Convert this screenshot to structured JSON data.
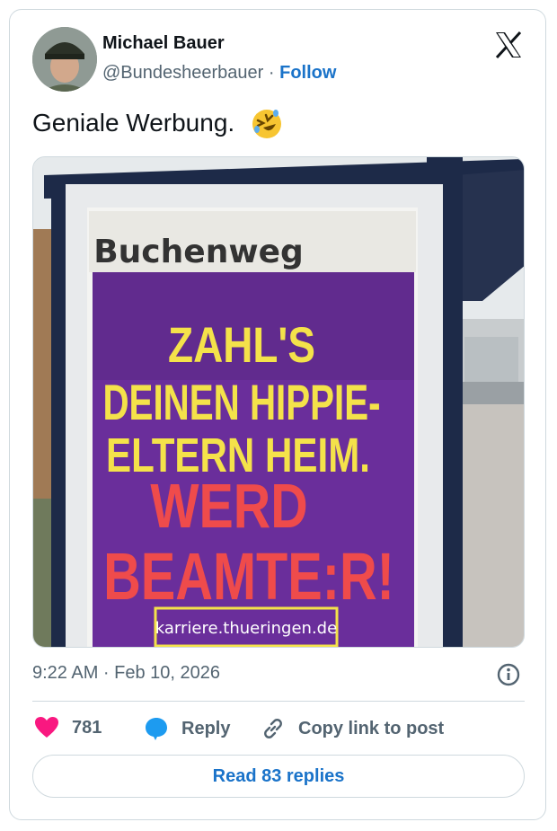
{
  "author": {
    "name": "Michael Bauer",
    "handle": "@Bundesheerbauer",
    "separator": " · ",
    "follow_label": "Follow"
  },
  "tweet": {
    "text": "Geniale Werbung.",
    "emoji_icon": "rolling-on-floor-laughing-emoji"
  },
  "media": {
    "poster": {
      "street_sign": "Buchenweg",
      "line1": "ZAHL'S",
      "line2": "DEINEN HIPPIE-",
      "line3": "ELTERN HEIM.",
      "line4": "WERD",
      "line5": "BEAMTE:R!",
      "url": "karriere.thueringen.de"
    }
  },
  "meta": {
    "timestamp": "9:22 AM · Feb 10, 2026"
  },
  "actions": {
    "like_count": "781",
    "reply_label": "Reply",
    "copy_label": "Copy link to post"
  },
  "read_replies_label": "Read 83 replies",
  "colors": {
    "like": "#f91880",
    "reply": "#1d9bf0",
    "link": "#1a73c9",
    "poster_purple": "#6a2e9b",
    "poster_yellow": "#f4e24a",
    "poster_red": "#ef4b4b",
    "shelter_frame": "#1d2a48"
  }
}
